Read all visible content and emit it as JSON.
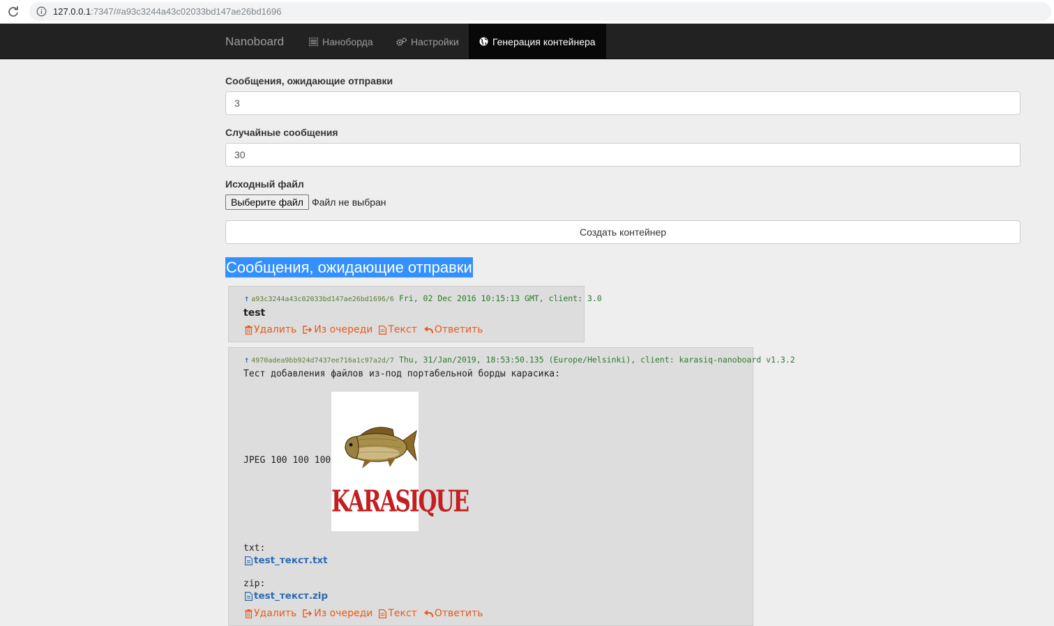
{
  "browser": {
    "url_host": "127.0.0.1",
    "url_rest": ":7347/#a93c3244a43c02033bd147ae26bd1696"
  },
  "navbar": {
    "brand": "Nanoboard",
    "items": [
      {
        "label": "Нанобoрда",
        "icon": "list-icon"
      },
      {
        "label": "Настройки",
        "icon": "gears-icon"
      },
      {
        "label": "Генерация контейнера",
        "icon": "globe-icon",
        "active": true
      }
    ]
  },
  "form": {
    "pending_label": "Сообщения, ожидающие отправки",
    "pending_value": "3",
    "random_label": "Случайные сообщения",
    "random_value": "30",
    "source_label": "Исходный файл",
    "file_button": "Выберите файл",
    "file_status": "Файл не выбран",
    "create_button": "Создать контейнер"
  },
  "section_title": "Сообщения, ожидающие отправки",
  "posts": [
    {
      "hash": "a93c3244a43c02033bd147ae26bd1696/6",
      "meta": "Fri, 02 Dec 2016 10:15:13 GMT, client: 3.0",
      "text": "test"
    },
    {
      "hash": "4970adea9bb924d7437ee716a1c97a2d/7",
      "meta": "Thu, 31/Jan/2019, 18:53:50.135 (Europe/Helsinki), client: karasiq-nanoboard v1.3.2",
      "text": "Тест добавления файлов из-под портабельной борды карасика:",
      "jpeg_label": "JPEG 100 100 100:",
      "image_caption": "KARASIQUE",
      "txt_label": "txt:",
      "txt_file": "test_текст.txt",
      "zip_label": "zip:",
      "zip_file": "test_текст.zip"
    }
  ],
  "actions": {
    "delete": "Удалить",
    "dequeue": "Из очереди",
    "text": "Текст",
    "reply": "Ответить"
  },
  "colors": {
    "navbar_bg": "#222222",
    "accent_link": "#e85a1a",
    "selection": "#3390ff",
    "post_meta": "#2a7a2a"
  }
}
